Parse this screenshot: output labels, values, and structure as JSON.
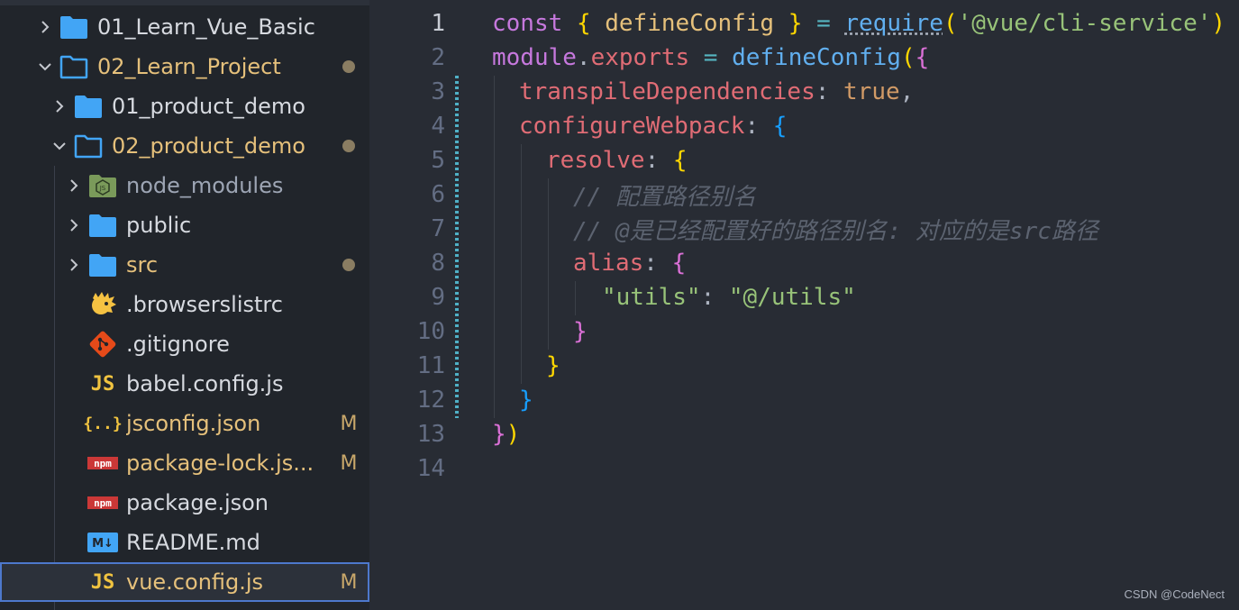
{
  "explorer": {
    "items": [
      {
        "label": "01_Learn_Vue_Basic",
        "badge": "",
        "dot": false
      },
      {
        "label": "02_Learn_Project",
        "badge": "",
        "dot": true
      },
      {
        "label": "01_product_demo",
        "badge": "",
        "dot": false
      },
      {
        "label": "02_product_demo",
        "badge": "",
        "dot": true
      },
      {
        "label": "node_modules",
        "badge": "",
        "dot": false
      },
      {
        "label": "public",
        "badge": "",
        "dot": false
      },
      {
        "label": "src",
        "badge": "",
        "dot": true
      },
      {
        "label": ".browserslistrc",
        "badge": "",
        "dot": false
      },
      {
        "label": ".gitignore",
        "badge": "",
        "dot": false
      },
      {
        "label": "babel.config.js",
        "badge": "",
        "dot": false
      },
      {
        "label": "jsconfig.json",
        "badge": "M",
        "dot": false
      },
      {
        "label": "package-lock.js...",
        "badge": "M",
        "dot": false
      },
      {
        "label": "package.json",
        "badge": "",
        "dot": false
      },
      {
        "label": "README.md",
        "badge": "",
        "dot": false
      },
      {
        "label": "vue.config.js",
        "badge": "M",
        "dot": false
      }
    ],
    "icon_text": {
      "js": "JS",
      "json": "{..}",
      "npm": "npm",
      "md": "M↓",
      "node": "JS"
    }
  },
  "editor": {
    "line_numbers": [
      "1",
      "2",
      "3",
      "4",
      "5",
      "6",
      "7",
      "8",
      "9",
      "10",
      "11",
      "12",
      "13",
      "14"
    ],
    "active_line": "1",
    "tokens": {
      "l1": [
        "const",
        " ",
        "{",
        " ",
        "defineConfig",
        " ",
        "}",
        " ",
        "=",
        " ",
        "require",
        "(",
        "'@vue/cli-service'",
        ")"
      ],
      "l2": [
        "module",
        ".",
        "exports",
        " = ",
        "defineConfig",
        "(",
        "{"
      ],
      "l3": [
        "transpileDependencies",
        ": ",
        "true",
        ","
      ],
      "l4": [
        "configureWebpack",
        ": ",
        "{"
      ],
      "l5": [
        "resolve",
        ": ",
        "{"
      ],
      "l6": [
        "// 配置路径别名"
      ],
      "l7": [
        "// @是已经配置好的路径别名: 对应的是src路径"
      ],
      "l8": [
        "alias",
        ": ",
        "{"
      ],
      "l9": [
        "\"utils\"",
        ": ",
        "\"@/utils\""
      ],
      "l10": [
        "}"
      ],
      "l11": [
        "}"
      ],
      "l12": [
        "}"
      ],
      "l13": [
        "}",
        ")"
      ]
    }
  },
  "watermark": "CSDN @CodeNect",
  "colors": {
    "sidebar_bg": "#21252b",
    "editor_bg": "#282c34",
    "folder": "#42a5f5",
    "modified": "#e5c07b",
    "selection_border": "#4d78cc"
  }
}
